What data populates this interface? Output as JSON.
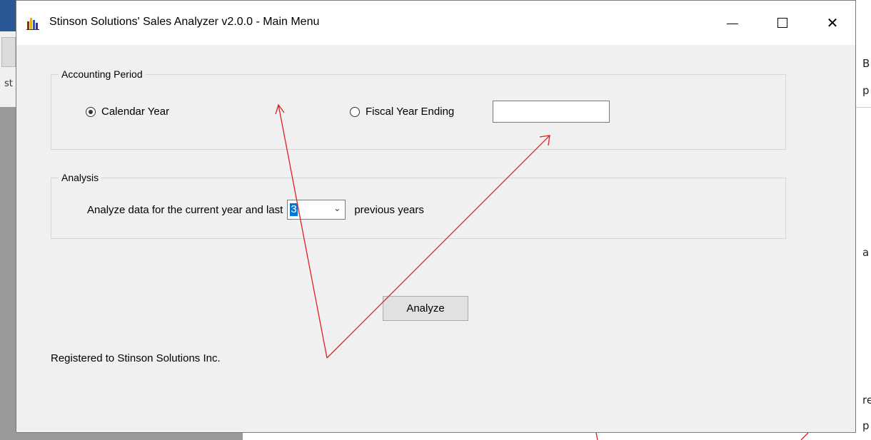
{
  "window": {
    "title": "Stinson Solutions' Sales Analyzer v2.0.0 - Main Menu",
    "minimize_icon": "minimize-icon",
    "maximize_icon": "maximize-icon",
    "close_icon": "close-icon",
    "close_glyph": "✕"
  },
  "accounting_period": {
    "group_title": "Accounting Period",
    "calendar_year_label": "Calendar Year",
    "calendar_year_checked": true,
    "fiscal_year_label": "Fiscal Year Ending",
    "fiscal_year_checked": false,
    "fiscal_year_value": ""
  },
  "analysis": {
    "group_title": "Analysis",
    "prefix_text": "Analyze data for the current year and last",
    "years_value": "3",
    "suffix_text": "previous years"
  },
  "analyze_button": "Analyze",
  "registered_text": "Registered to Stinson Solutions Inc.",
  "annotation_color": "#e02020",
  "background_app": {
    "left_text": "st",
    "right_letters": [
      "B",
      "p",
      "a",
      "re",
      "p"
    ]
  }
}
